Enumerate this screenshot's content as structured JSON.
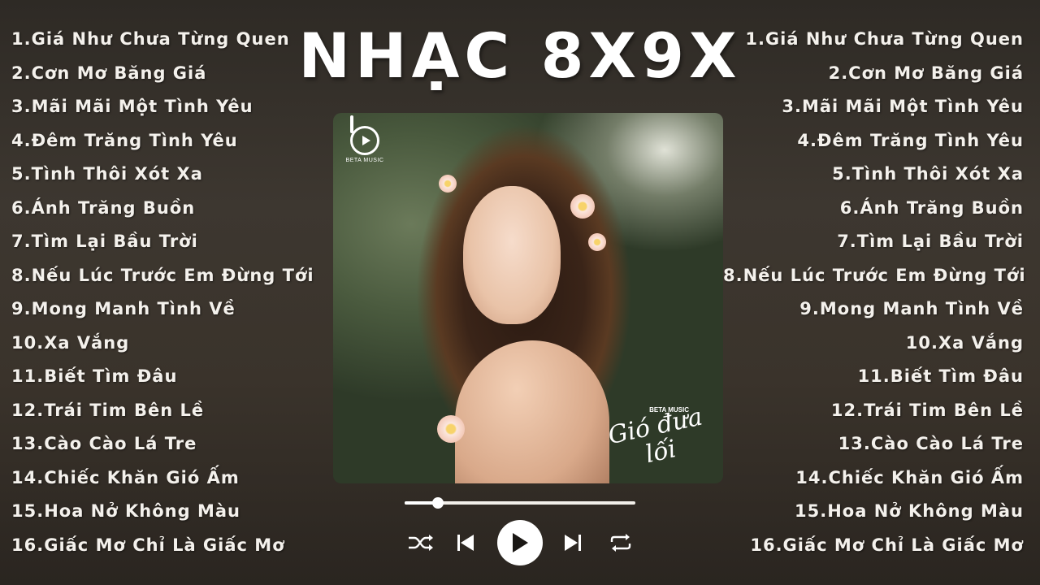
{
  "header": {
    "title": "NHẠC 8X9X"
  },
  "playlist_left": [
    "1.Giá Như Chưa Từng Quen",
    "2.Cơn Mơ Băng Giá",
    "3.Mãi Mãi Một Tình Yêu",
    "4.Đêm Trăng Tình Yêu",
    "5.Tình Thôi Xót Xa",
    "6.Ánh Trăng Buồn",
    "7.Tìm Lại Bầu Trời",
    "8.Nếu Lúc Trước Em Đừng Tới",
    "9.Mong Manh Tình Về",
    "10.Xa Vắng",
    "11.Biết Tìm Đâu",
    "12.Trái Tim Bên Lề",
    "13.Cào Cào Lá Tre",
    "14.Chiếc Khăn Gió Ấm",
    "15.Hoa Nở Không Màu",
    "16.Giấc Mơ Chỉ Là Giấc Mơ"
  ],
  "playlist_right": [
    "1.Giá Như Chưa Từng Quen",
    "2.Cơn Mơ Băng Giá",
    "3.Mãi Mãi Một Tình Yêu",
    "4.Đêm Trăng Tình Yêu",
    "5.Tình Thôi Xót Xa",
    "6.Ánh Trăng Buồn",
    "7.Tìm Lại Bầu Trời",
    "8.Nếu Lúc Trước Em Đừng Tới",
    "9.Mong Manh Tình Về",
    "10.Xa Vắng",
    "11.Biết Tìm Đâu",
    "12.Trái Tim Bên Lề",
    "13.Cào Cào Lá Tre",
    "14.Chiếc Khăn Gió Ấm",
    "15.Hoa Nở Không Màu",
    "16.Giấc Mơ Chỉ Là Giấc Mơ"
  ],
  "cover": {
    "logo_text": "BETA MUSIC",
    "signature_brand": "BETA MUSIC",
    "signature_script": "Gió đưa lối"
  },
  "player": {
    "progress": 0.145,
    "icons": {
      "shuffle": "shuffle-icon",
      "previous": "previous-icon",
      "play": "play-icon",
      "next": "next-icon",
      "repeat": "repeat-icon"
    }
  }
}
